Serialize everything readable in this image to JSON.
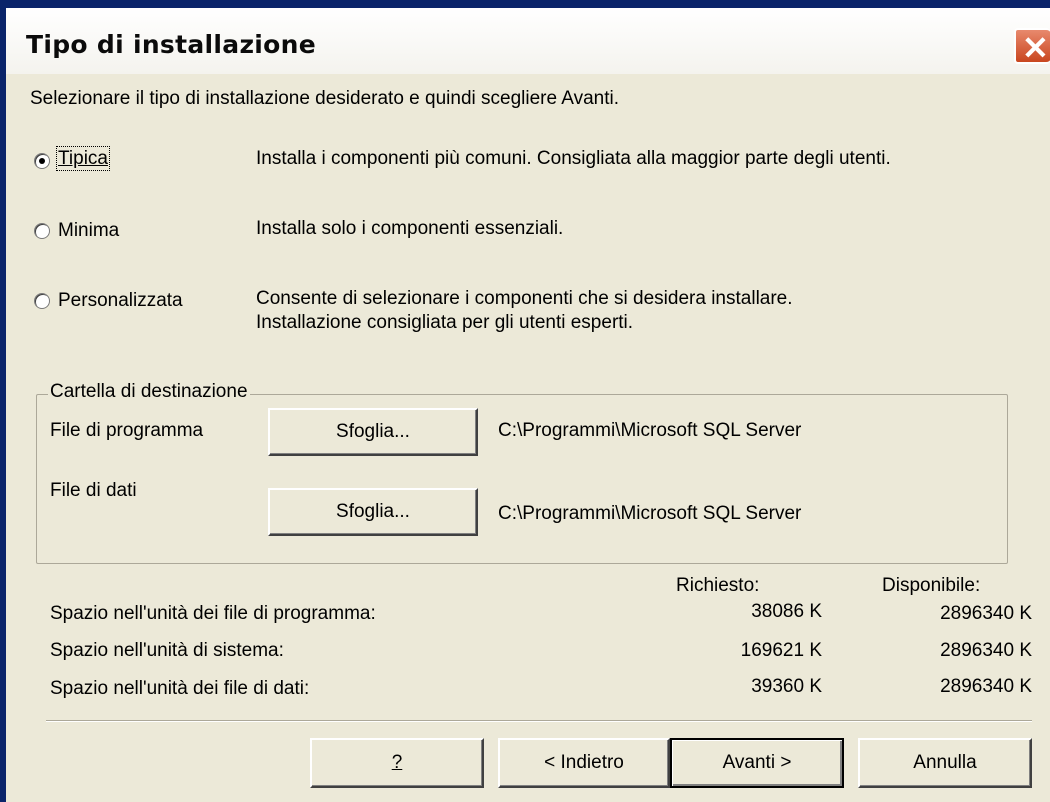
{
  "dialog": {
    "title": "Tipo di installazione",
    "instruction": "Selezionare il tipo di installazione desiderato e quindi scegliere Avanti."
  },
  "setup_types": [
    {
      "label": "Tipica",
      "description": "Installa i componenti più comuni. Consigliata alla maggior parte degli utenti.",
      "checked": true
    },
    {
      "label": "Minima",
      "description": "Installa solo i componenti essenziali.",
      "checked": false
    },
    {
      "label": "Personalizzata",
      "description_line1": "Consente di selezionare i componenti che si desidera installare.",
      "description_line2": "Installazione consigliata per gli utenti esperti.",
      "checked": false
    }
  ],
  "destination": {
    "group_label": "Cartella di destinazione",
    "program_files_label": "File di programma",
    "program_files_path": "C:\\Programmi\\Microsoft SQL Server",
    "data_files_label": "File di dati",
    "data_files_path": "C:\\Programmi\\Microsoft SQL Server",
    "browse_label": "Sfoglia..."
  },
  "space": {
    "required_header": "Richiesto:",
    "available_header": "Disponibile:",
    "rows": [
      {
        "label": "Spazio nell'unità dei file di programma:",
        "required": "38086 K",
        "available": "2896340 K"
      },
      {
        "label": "Spazio nell'unità di sistema:",
        "required": "169621 K",
        "available": "2896340 K"
      },
      {
        "label": "Spazio nell'unità dei file di dati:",
        "required": "39360 K",
        "available": "2896340 K"
      }
    ]
  },
  "buttons": {
    "help": "?",
    "back": "< Indietro",
    "next": "Avanti >",
    "cancel": "Annulla"
  },
  "colors": {
    "dialog_bg": "#ece9d8",
    "close_button": "#c9461f"
  },
  "icons": {
    "close": "close-icon"
  }
}
